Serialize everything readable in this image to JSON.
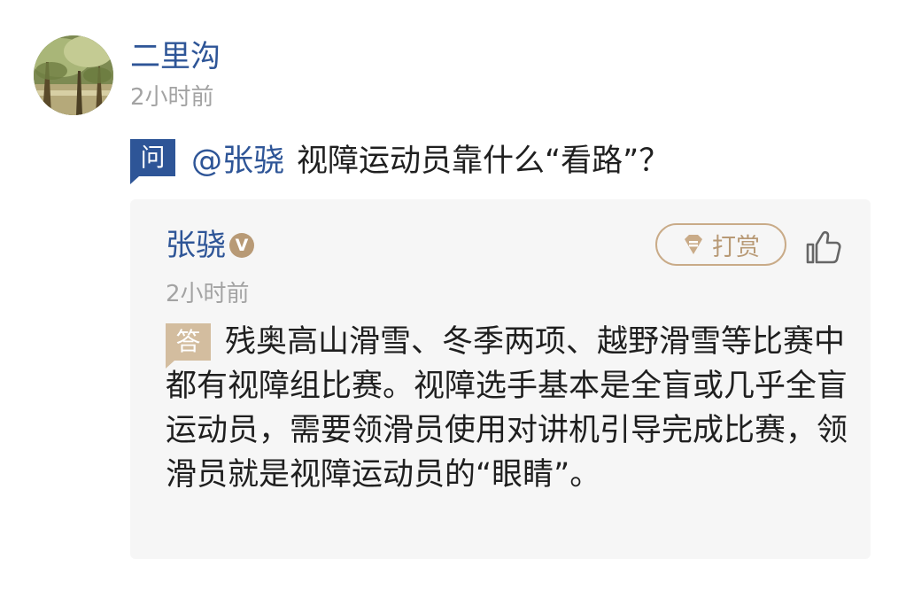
{
  "post": {
    "username": "二里沟",
    "time": "2小时前"
  },
  "question": {
    "badge": "问",
    "mention": "@张骁",
    "text": "视障运动员靠什么“看路”？"
  },
  "answer": {
    "author": "张骁",
    "verified_badge": "V",
    "tip_label": "打赏",
    "time": "2小时前",
    "badge": "答",
    "text": "残奥高山滑雪、冬季两项、越野滑雪等比赛中都有视障组比赛。视障选手基本是全盲或几乎全盲运动员，需要领滑员使用对讲机引导完成比赛，领滑员就是视障运动员的“眼睛”。"
  },
  "icons": {
    "avatar": "avatar-image",
    "tip": "tip-icon",
    "like": "thumbs-up-icon",
    "verified": "verified-v-icon"
  },
  "colors": {
    "link_blue": "#2e5597",
    "gold": "#b89a76",
    "answer_badge": "#d3bd9f",
    "card_bg": "#f6f6f6",
    "muted_text": "#a3a3a3"
  }
}
